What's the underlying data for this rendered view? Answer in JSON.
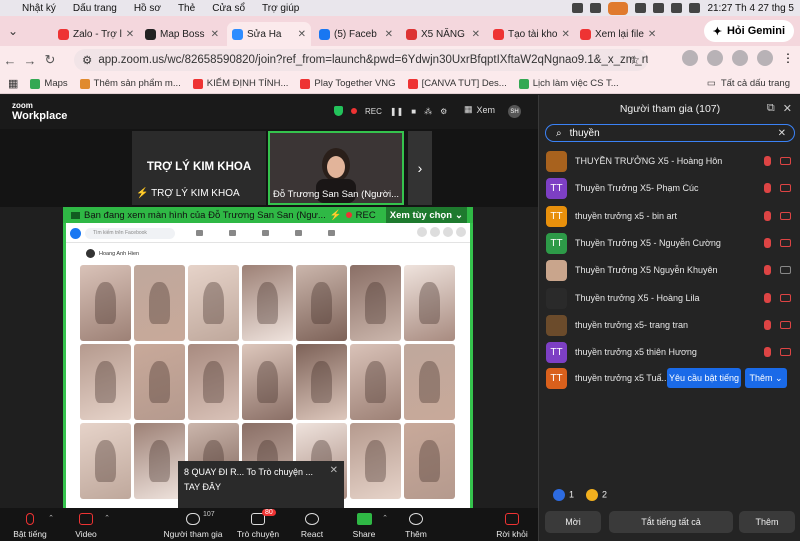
{
  "menubar": {
    "items": [
      "Nhật ký",
      "Dấu trang",
      "Hồ sơ",
      "Thẻ",
      "Cửa sổ",
      "Trợ giúp"
    ],
    "clock": "21:27 Th 4 27 thg 5"
  },
  "tabs": [
    {
      "label": "Zalo - Trợ l",
      "color": "#e33"
    },
    {
      "label": "Map Boss",
      "color": "#222"
    },
    {
      "label": "Sửa Ha",
      "color": "#2d8cff"
    },
    {
      "label": "(5) Faceb",
      "color": "#1877f2"
    },
    {
      "label": "X5 NĂNG",
      "color": "#d33"
    },
    {
      "label": "Tạo tài kho",
      "color": "#e33"
    },
    {
      "label": "Xem lại file",
      "color": "#e33"
    }
  ],
  "gemini_label": "Hỏi Gemini",
  "url": "app.zoom.us/wc/82658590820/join?ref_from=launch&pwd=6Ydwjn30UxrBfqptIXftaW2qNgnao9.1&_x_zm_rtaid=5jRQ...",
  "bookmarks": [
    {
      "label": "Maps",
      "color": "#34a853"
    },
    {
      "label": "Thêm sản phẩm m...",
      "color": "#e08a2e"
    },
    {
      "label": "KIỂM ĐỊNH TÍNH...",
      "color": "#e33"
    },
    {
      "label": "Play Together VNG",
      "color": "#e33"
    },
    {
      "label": "[CANVA TUT] Des...",
      "color": "#e33"
    },
    {
      "label": "Lịch làm việc CS T...",
      "color": "#34a853"
    }
  ],
  "all_bookmarks": "Tất cả dấu trang",
  "zoom": {
    "logo_top": "zoom",
    "logo_bottom": "Workplace",
    "rec": "REC",
    "view": "Xem"
  },
  "thumbs": {
    "t1_name": "TRỢ LÝ KIM KHOA",
    "t1_label": "TRỢ LÝ KIM KHOA",
    "t2_label": "Đỗ Trương San San (Người..."
  },
  "share": {
    "banner": "Bạn đang xem màn hình của  Đỗ Trương San San (Ngư...",
    "rec": "REC",
    "view_option": "Xem tùy chọn"
  },
  "fb": {
    "search": "Tìm kiếm trên Facebook",
    "profile": "Hoang Anh Hien"
  },
  "chat_popup": {
    "line1": "8 QUAY ĐI R... To Trò chuyện ...",
    "line2": "TAY ĐÂY"
  },
  "toolbar": [
    {
      "label": "Bật tiếng",
      "icon": "mic-off-icon"
    },
    {
      "label": "Video",
      "icon": "video-icon"
    },
    {
      "label": "Người tham gia",
      "icon": "participants-icon",
      "count": "107"
    },
    {
      "label": "Trò chuyện",
      "icon": "chat-icon",
      "badge": "80"
    },
    {
      "label": "React",
      "icon": "react-icon"
    },
    {
      "label": "Share",
      "icon": "share-icon"
    },
    {
      "label": "Thêm",
      "icon": "more-icon"
    },
    {
      "label": "Rời khỏi",
      "icon": "leave-icon"
    }
  ],
  "panel": {
    "title": "Người tham gia (107)",
    "search": "thuyền",
    "participants": [
      {
        "name": "THUYỀN TRƯỞNG X5 - Hoàng Hôn",
        "initials": "",
        "color": "#a8621e",
        "cam": "red"
      },
      {
        "name": "Thuyền Trưởng X5- Phạm Cúc",
        "initials": "TT",
        "color": "#7d3fc4",
        "cam": "red"
      },
      {
        "name": "thuyền trưởng x5 - bin art",
        "initials": "TT",
        "color": "#e8900c",
        "cam": "red"
      },
      {
        "name": "Thuyền Trưởng X5 - Nguyễn Cường",
        "initials": "TT",
        "color": "#2d9a48",
        "cam": "red"
      },
      {
        "name": "Thuyền Trưởng X5 Nguyễn Khuyên",
        "initials": "",
        "color": "#c9a58c",
        "cam": "grey"
      },
      {
        "name": "Thuyền trưởng X5 - Hoàng Lila",
        "initials": "",
        "color": "#2a2a2a",
        "cam": "red"
      },
      {
        "name": "thuyền trưởng x5- trang tran",
        "initials": "",
        "color": "#6b4b2b",
        "cam": "red"
      },
      {
        "name": "thuyền trưởng x5 thiên Hương",
        "initials": "TT",
        "color": "#7d3fc4",
        "cam": "red"
      }
    ],
    "last": {
      "name": "thuyền trưởng x5 Tuấ...",
      "initials": "TT",
      "color": "#d9601c",
      "unmute": "Yêu cầu bật tiếng",
      "more": "Thêm"
    },
    "reactions": [
      {
        "count": "1",
        "color": "#2d6be0"
      },
      {
        "count": "2",
        "color": "#f2b01e"
      }
    ],
    "buttons": {
      "invite": "Mời",
      "mute_all": "Tắt tiếng tất cả",
      "more": "Thêm"
    }
  }
}
